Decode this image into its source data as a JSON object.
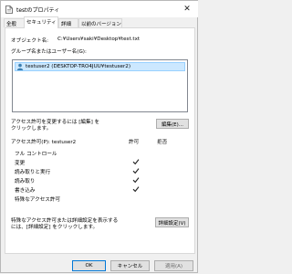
{
  "window": {
    "title": "testのプロパティ",
    "close_glyph": "✕"
  },
  "tabs": [
    {
      "label": "全般"
    },
    {
      "label": "セキュリティ"
    },
    {
      "label": "詳細"
    },
    {
      "label": "以前のバージョン"
    }
  ],
  "object": {
    "label": "オブジェクト名:",
    "value": "C:¥Users¥saki¥Desktop¥test.txt"
  },
  "group_label": "グループ名またはユーザー名(G):",
  "users": [
    {
      "name": "testuser2 (DESKTOP-TRO4JUU¥testuser2)",
      "selected": true
    }
  ],
  "change_perm": {
    "text_line1": "アクセス許可を変更するには [編集] を",
    "text_line2": "クリックします。",
    "edit_button": "編集(E)..."
  },
  "permissions": {
    "header": "アクセス許可(P): testuser2",
    "allow_header": "許可",
    "deny_header": "拒否",
    "rows": [
      {
        "name": "フル コントロール",
        "allow": false
      },
      {
        "name": "変更",
        "allow": true
      },
      {
        "name": "読み取りと実行",
        "allow": true
      },
      {
        "name": "読み取り",
        "allow": true
      },
      {
        "name": "書き込み",
        "allow": true
      },
      {
        "name": "特殊なアクセス許可",
        "allow": false
      }
    ]
  },
  "advanced": {
    "text_line1": "特殊なアクセス許可または詳細設定を表示する",
    "text_line2": "には、[詳細設定] をクリックします。",
    "button": "詳細設定(V)"
  },
  "dialog_buttons": {
    "ok": "OK",
    "cancel": "キャンセル",
    "apply": "適用(A)"
  },
  "colors": {
    "selection": "#cce8ff",
    "accent": "#0078d7"
  }
}
